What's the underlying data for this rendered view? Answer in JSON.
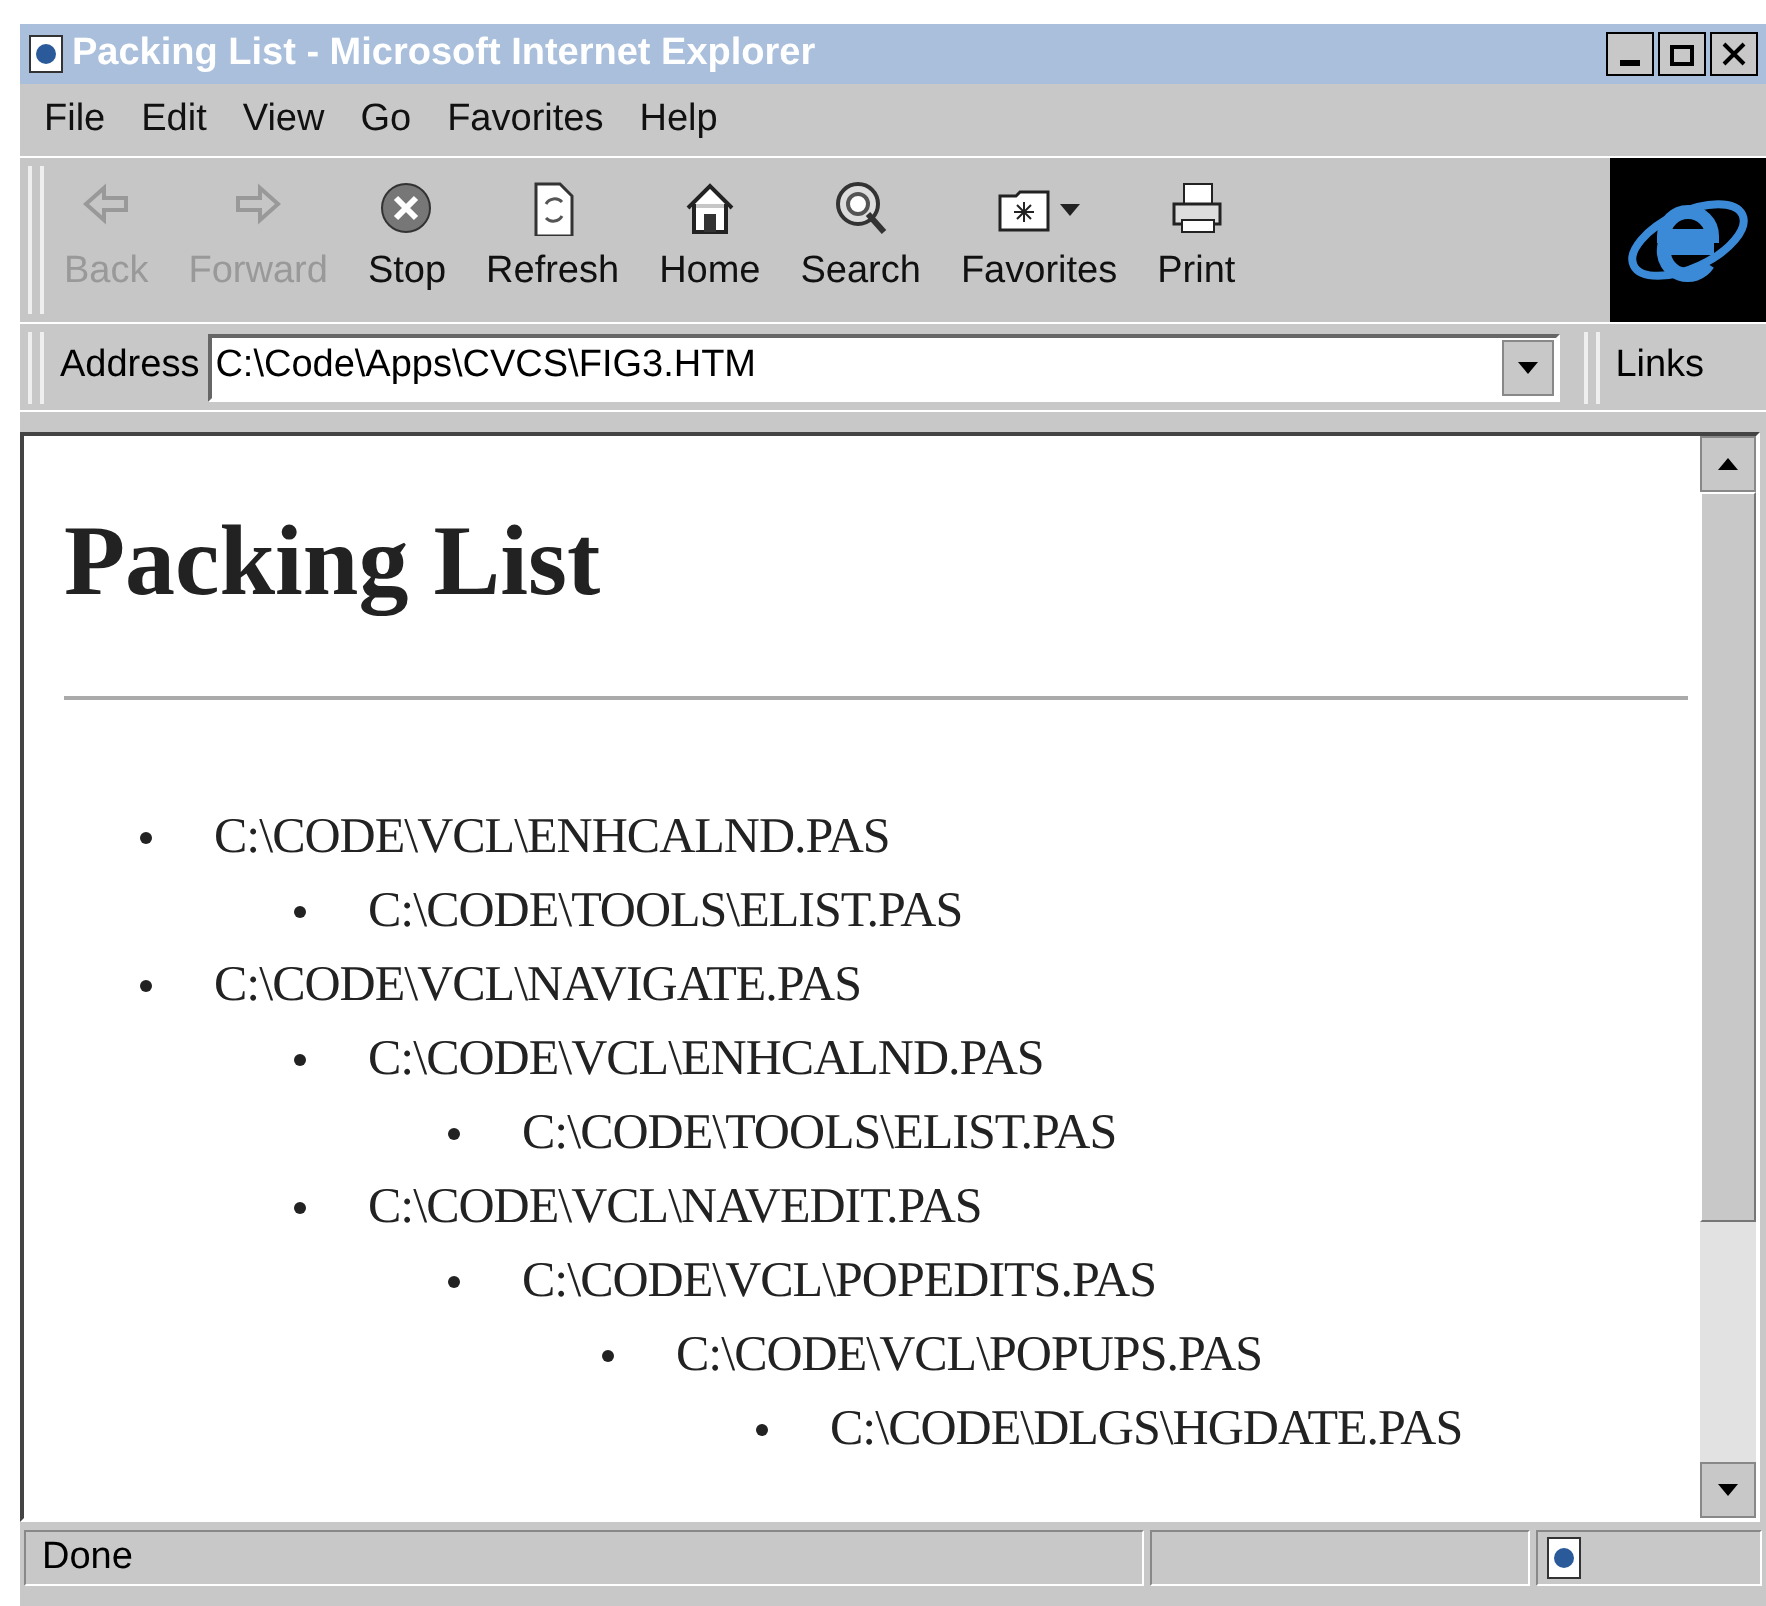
{
  "window": {
    "title": "Packing List - Microsoft Internet Explorer"
  },
  "menu": [
    "File",
    "Edit",
    "View",
    "Go",
    "Favorites",
    "Help"
  ],
  "toolbar": [
    {
      "label": "Back",
      "kind": "back",
      "disabled": true
    },
    {
      "label": "Forward",
      "kind": "forward",
      "disabled": true
    },
    {
      "label": "Stop",
      "kind": "stop",
      "disabled": false
    },
    {
      "label": "Refresh",
      "kind": "refresh",
      "disabled": false
    },
    {
      "label": "Home",
      "kind": "home",
      "disabled": false
    },
    {
      "label": "Search",
      "kind": "search",
      "disabled": false
    },
    {
      "label": "Favorites",
      "kind": "favorites",
      "disabled": false
    },
    {
      "label": "Print",
      "kind": "print",
      "disabled": false
    }
  ],
  "address": {
    "label": "Address",
    "value": "C:\\Code\\Apps\\CVCS\\FIG3.HTM",
    "links": "Links"
  },
  "page": {
    "heading": "Packing List",
    "items": [
      {
        "text": "C:\\CODE\\VCL\\ENHCALND.PAS",
        "children": [
          {
            "text": "C:\\CODE\\TOOLS\\ELIST.PAS"
          }
        ]
      },
      {
        "text": "C:\\CODE\\VCL\\NAVIGATE.PAS",
        "children": [
          {
            "text": "C:\\CODE\\VCL\\ENHCALND.PAS",
            "children": [
              {
                "text": "C:\\CODE\\TOOLS\\ELIST.PAS"
              }
            ]
          },
          {
            "text": "C:\\CODE\\VCL\\NAVEDIT.PAS",
            "children": [
              {
                "text": "C:\\CODE\\VCL\\POPEDITS.PAS",
                "children": [
                  {
                    "text": "C:\\CODE\\VCL\\POPUPS.PAS",
                    "children": [
                      {
                        "text": "C:\\CODE\\DLGS\\HGDATE.PAS"
                      }
                    ]
                  }
                ]
              }
            ]
          }
        ]
      }
    ]
  },
  "status_bar": {
    "text": "Done"
  }
}
